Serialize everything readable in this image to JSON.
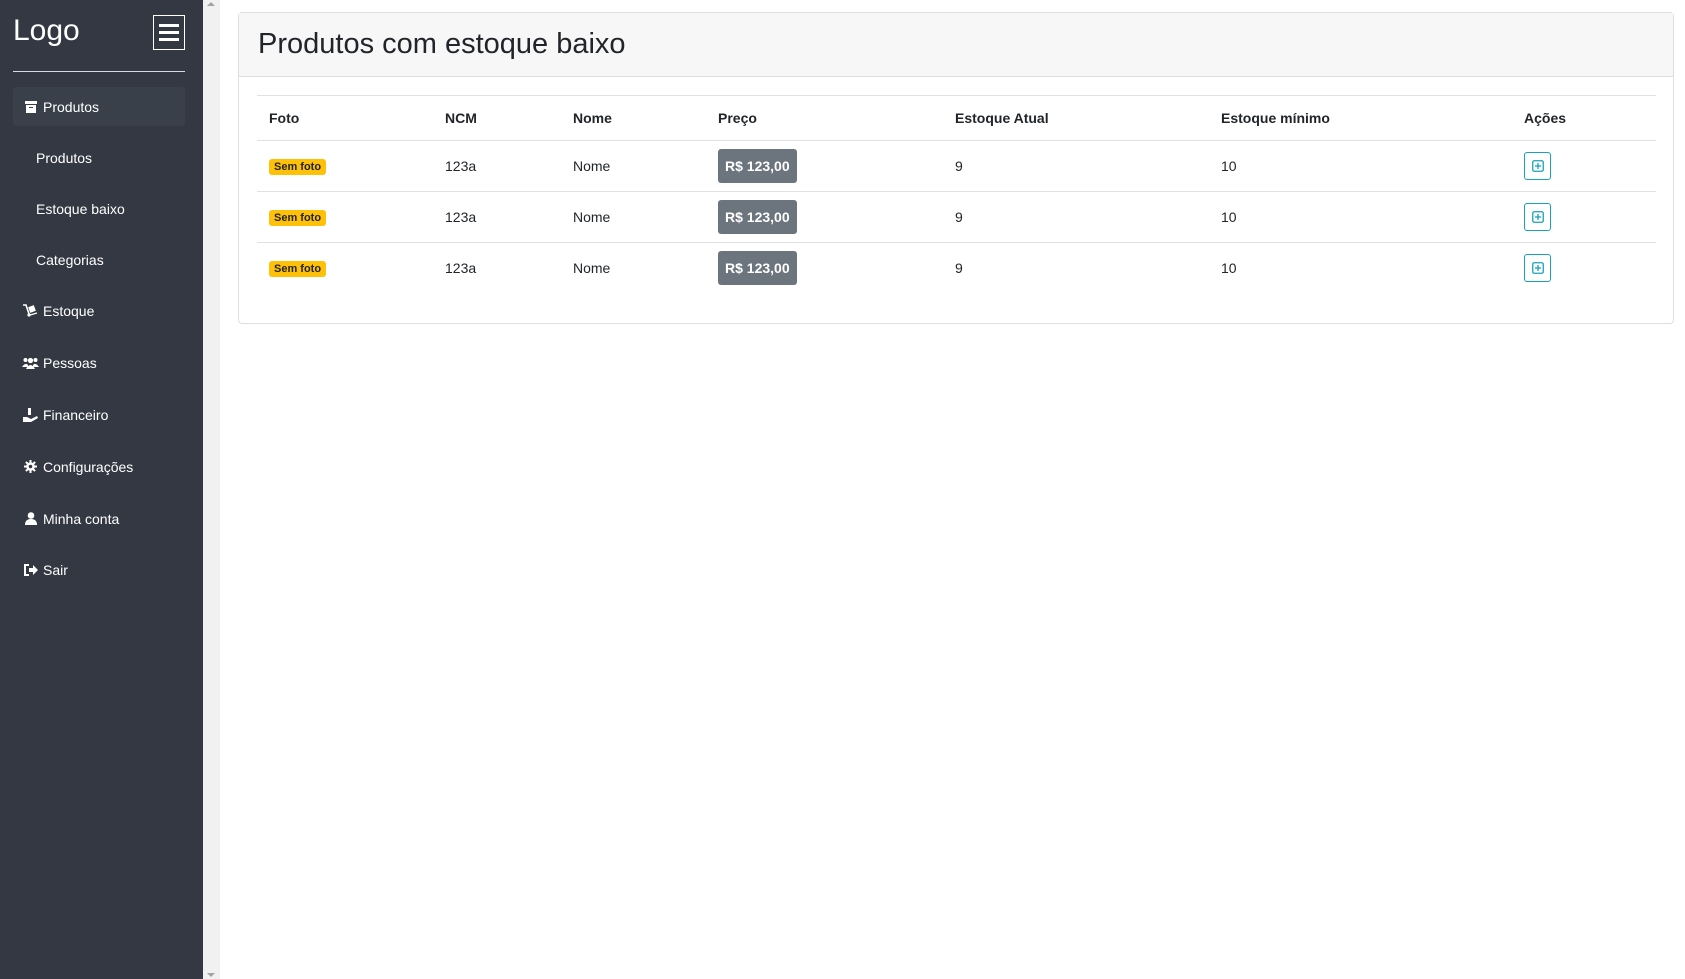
{
  "sidebar": {
    "logo": "Logo",
    "menu_button_icon": "hamburger-icon",
    "items": [
      {
        "label": "Produtos",
        "icon": "box-icon",
        "active": true,
        "sub": false
      },
      {
        "label": "Produtos",
        "icon": null,
        "active": false,
        "sub": true
      },
      {
        "label": "Estoque baixo",
        "icon": null,
        "active": false,
        "sub": true
      },
      {
        "label": "Categorias",
        "icon": null,
        "active": false,
        "sub": true
      },
      {
        "label": "Estoque",
        "icon": "dolly-icon",
        "active": false,
        "sub": false
      },
      {
        "label": "Pessoas",
        "icon": "users-icon",
        "active": false,
        "sub": false
      },
      {
        "label": "Financeiro",
        "icon": "hand-holding-dollar-icon",
        "active": false,
        "sub": false
      },
      {
        "label": "Configurações",
        "icon": "gear-icon",
        "active": false,
        "sub": false
      },
      {
        "label": "Minha conta",
        "icon": "user-icon",
        "active": false,
        "sub": false
      },
      {
        "label": "Sair",
        "icon": "sign-out-icon",
        "active": false,
        "sub": false
      }
    ]
  },
  "main": {
    "title": "Produtos com estoque baixo",
    "columns": [
      "Foto",
      "NCM",
      "Nome",
      "Preço",
      "Estoque Atual",
      "Estoque mínimo",
      "Ações"
    ],
    "rows": [
      {
        "foto": "Sem foto",
        "ncm": "123a",
        "nome": "Nome",
        "preco": "R$ 123,00",
        "estoque_atual": "9",
        "estoque_minimo": "10",
        "acao_icon": "plus-square-icon"
      },
      {
        "foto": "Sem foto",
        "ncm": "123a",
        "nome": "Nome",
        "preco": "R$ 123,00",
        "estoque_atual": "9",
        "estoque_minimo": "10",
        "acao_icon": "plus-square-icon"
      },
      {
        "foto": "Sem foto",
        "ncm": "123a",
        "nome": "Nome",
        "preco": "R$ 123,00",
        "estoque_atual": "9",
        "estoque_minimo": "10",
        "acao_icon": "plus-square-icon"
      }
    ]
  },
  "colors": {
    "sidebar_bg": "#333842",
    "badge_warning": "#ffc107",
    "price_badge": "#6c757d",
    "action_border": "#17a2b8"
  }
}
